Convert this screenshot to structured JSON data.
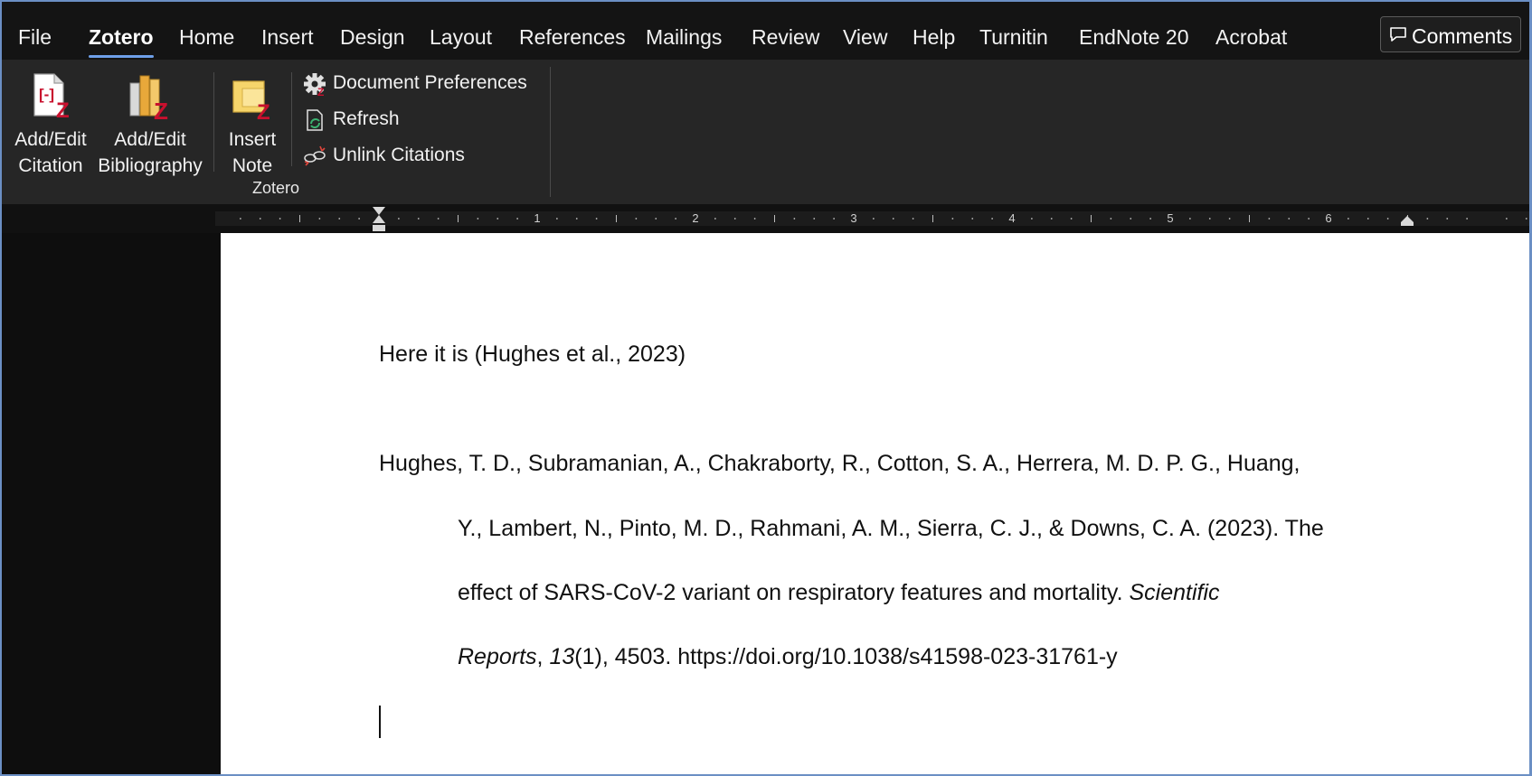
{
  "menu": {
    "tabs": [
      "File",
      "Zotero",
      "Home",
      "Insert",
      "Design",
      "Layout",
      "References",
      "Mailings",
      "Review",
      "View",
      "Help",
      "Turnitin",
      "EndNote 20",
      "Acrobat"
    ],
    "active_tab": "Zotero",
    "comments_label": "Comments"
  },
  "ribbon": {
    "add_edit_citation": [
      "Add/Edit",
      "Citation"
    ],
    "add_edit_bibliography": [
      "Add/Edit",
      "Bibliography"
    ],
    "insert_note": [
      "Insert",
      "Note"
    ],
    "document_preferences": "Document Preferences",
    "refresh": "Refresh",
    "unlink_citations": "Unlink Citations",
    "group_label": "Zotero"
  },
  "ruler": {
    "numbers": [
      "1",
      "2",
      "3",
      "4",
      "5",
      "6"
    ]
  },
  "document": {
    "citation_line": "Here it is (Hughes et al., 2023)",
    "bibliography": {
      "line1": "Hughes, T. D., Subramanian, A., Chakraborty, R., Cotton, S. A., Herrera, M. D. P. G., Huang,",
      "line2": "Y., Lambert, N., Pinto, M. D., Rahmani, A. M., Sierra, C. J., & Downs, C. A. (2023). The",
      "line3_plain": "effect of SARS-CoV-2 variant on respiratory features and mortality. ",
      "line3_italic": "Scientific",
      "line4_journal": "Reports",
      "line4_sep": ", ",
      "line4_volume": "13",
      "line4_rest": "(1), 4503. https://doi.org/10.1038/s41598-023-31761-y"
    }
  }
}
